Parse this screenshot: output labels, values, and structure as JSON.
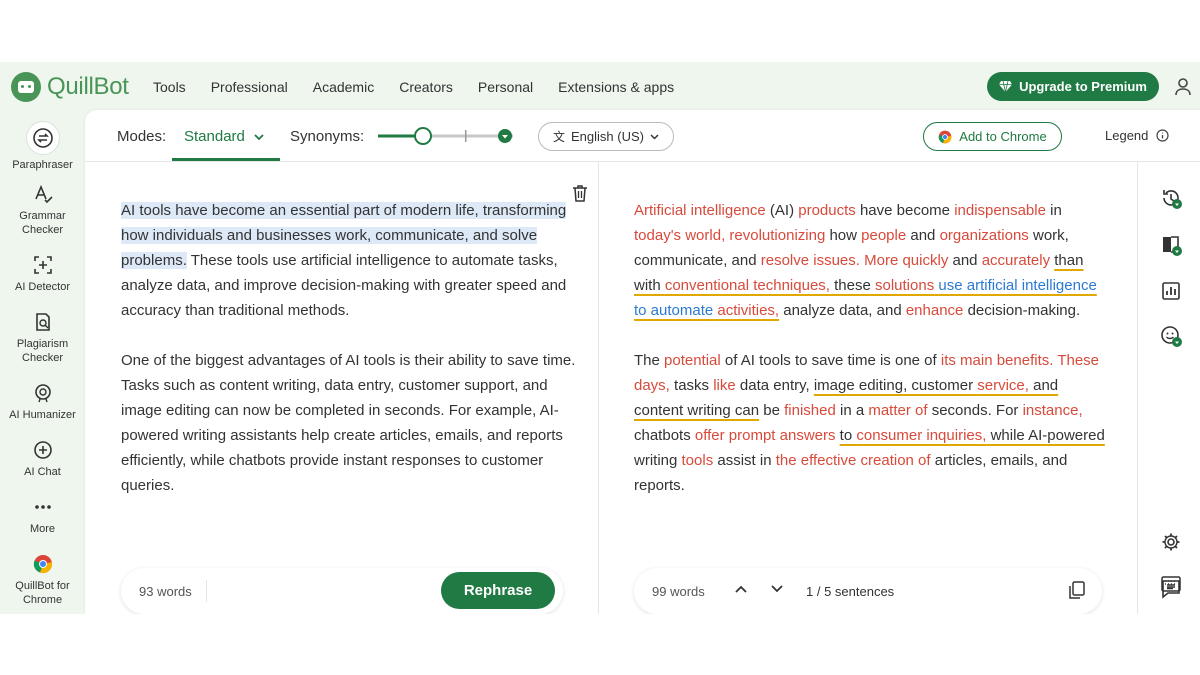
{
  "brand": {
    "name": "QuillBot",
    "accent": "#1f7a43",
    "logo_green": "#499557"
  },
  "nav": {
    "links": [
      "Tools",
      "Professional",
      "Academic",
      "Creators",
      "Personal",
      "Extensions & apps"
    ],
    "upgrade_label": "Upgrade to Premium"
  },
  "sidebar": {
    "items": [
      {
        "label": "Paraphraser",
        "icon": "paraphraser-icon"
      },
      {
        "label": "Grammar Checker",
        "icon": "grammar-icon"
      },
      {
        "label": "AI Detector",
        "icon": "ai-detector-icon"
      },
      {
        "label": "Plagiarism Checker",
        "icon": "plagiarism-icon"
      },
      {
        "label": "AI Humanizer",
        "icon": "humanizer-icon"
      },
      {
        "label": "AI Chat",
        "icon": "ai-chat-icon"
      },
      {
        "label": "More",
        "icon": "more-icon"
      },
      {
        "label": "QuillBot for Chrome",
        "icon": "chrome-icon"
      }
    ]
  },
  "toolbar": {
    "modes_label": "Modes:",
    "mode_selected": "Standard",
    "synonyms_label": "Synonyms:",
    "synonyms_level": 0.36,
    "language": "English (US)",
    "add_to_chrome": "Add to Chrome",
    "legend": "Legend"
  },
  "input": {
    "p1_highlight": "AI tools have become an essential part of modern life, transforming how individuals and businesses work, communicate, and solve problems.",
    "p1_rest": " These tools use artificial intelligence to automate tasks, analyze data, and improve decision-making with greater speed and accuracy than traditional methods.",
    "p2": "One of the biggest advantages of AI tools is their ability to save time. Tasks such as content writing, data entry, customer support, and image editing can now be completed in seconds. For example, AI-powered writing assistants help create articles, emails, and reports efficiently, while chatbots provide instant responses to customer queries.",
    "word_count": "93 words",
    "rephrase_label": "Rephrase"
  },
  "output": {
    "p1": [
      [
        "Artificial intelligence",
        "r"
      ],
      [
        " (AI) ",
        ""
      ],
      [
        "products",
        "r"
      ],
      [
        " have become ",
        ""
      ],
      [
        "indispensable",
        "r"
      ],
      [
        " in ",
        ""
      ],
      [
        "today's world, revolutionizing",
        "r"
      ],
      [
        " how ",
        ""
      ],
      [
        "people",
        "r"
      ],
      [
        " and ",
        ""
      ],
      [
        "organizations",
        "r"
      ],
      [
        " work, communicate, and ",
        ""
      ],
      [
        "resolve issues.",
        "r"
      ],
      [
        " ",
        ""
      ],
      [
        "More quickly",
        "r"
      ],
      [
        " and ",
        ""
      ],
      [
        "accurately",
        "r"
      ],
      [
        " ",
        ""
      ],
      [
        "than",
        "u"
      ],
      [
        " ",
        ""
      ],
      [
        "with ",
        "u"
      ],
      [
        "conventional techniques,",
        "ru"
      ],
      [
        " these ",
        "u"
      ],
      [
        "solutions",
        "ru"
      ],
      [
        " ",
        "u"
      ],
      [
        "use artificial intelligence",
        "bu"
      ],
      [
        " ",
        "u"
      ],
      [
        "to automate",
        "bu"
      ],
      [
        " ",
        "u"
      ],
      [
        "activities,",
        "ru"
      ],
      [
        " analyze data, and ",
        ""
      ],
      [
        "enhance",
        "r"
      ],
      [
        " decision-making.",
        ""
      ]
    ],
    "p2": [
      [
        "The ",
        ""
      ],
      [
        "potential",
        "r"
      ],
      [
        " of AI tools to save time is one of ",
        ""
      ],
      [
        "its main benefits.",
        "r"
      ],
      [
        " ",
        ""
      ],
      [
        "These days,",
        "r"
      ],
      [
        " tasks ",
        ""
      ],
      [
        "like",
        "r"
      ],
      [
        " data entry, ",
        ""
      ],
      [
        "image editing, customer ",
        "u"
      ],
      [
        "service,",
        "ru"
      ],
      [
        " and ",
        "u"
      ],
      [
        "content writing can",
        "u"
      ],
      [
        " be ",
        ""
      ],
      [
        "finished",
        "r"
      ],
      [
        " in a ",
        ""
      ],
      [
        "matter of",
        "r"
      ],
      [
        " seconds. For ",
        ""
      ],
      [
        "instance,",
        "r"
      ],
      [
        " chatbots ",
        ""
      ],
      [
        "offer prompt answers",
        "r"
      ],
      [
        " ",
        ""
      ],
      [
        "to ",
        "u"
      ],
      [
        "consumer inquiries,",
        "ru"
      ],
      [
        " while AI-",
        "u"
      ],
      [
        "powered",
        "u"
      ],
      [
        " writing ",
        ""
      ],
      [
        "tools",
        "r"
      ],
      [
        " assist in ",
        ""
      ],
      [
        "the effective creation of",
        "r"
      ],
      [
        " articles, emails, and reports.",
        ""
      ]
    ],
    "word_count": "99 words",
    "sentences": "1 / 5 sentences"
  },
  "colors": {
    "changed_word": "#d84a3b",
    "structural": "#2a7ad4",
    "longest_unchanged": "#e0a800",
    "highlight": "#dde9f7"
  }
}
